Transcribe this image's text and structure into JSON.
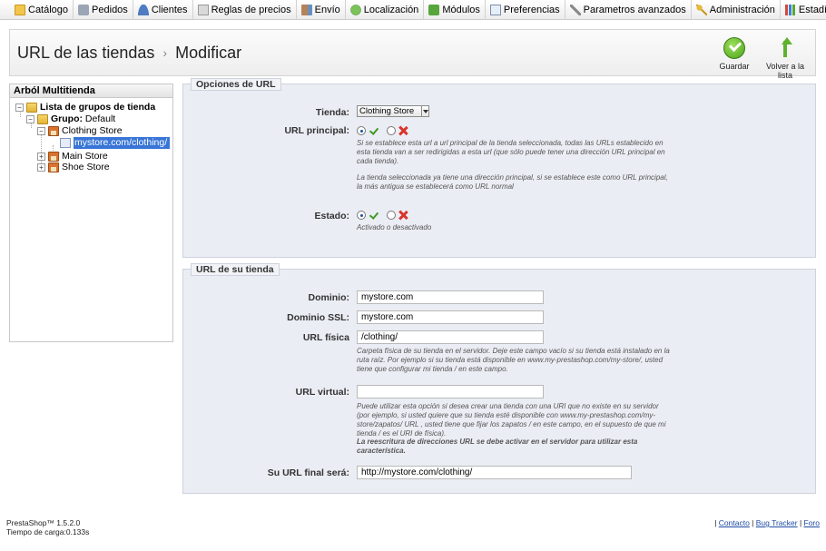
{
  "menu": {
    "items": [
      {
        "label": "Catálogo",
        "icon": "folder-icon"
      },
      {
        "label": "Pedidos",
        "icon": "cart-icon"
      },
      {
        "label": "Clientes",
        "icon": "customers-icon"
      },
      {
        "label": "Reglas de precios",
        "icon": "price-rules-icon"
      },
      {
        "label": "Envío",
        "icon": "truck-icon"
      },
      {
        "label": "Localización",
        "icon": "globe-icon"
      },
      {
        "label": "Módulos",
        "icon": "puzzle-icon"
      },
      {
        "label": "Preferencias",
        "icon": "preferences-icon"
      },
      {
        "label": "Parametros avanzados",
        "icon": "wrench-icon"
      },
      {
        "label": "Administración",
        "icon": "key-icon"
      },
      {
        "label": "Estadísticas",
        "icon": "stats-icon"
      }
    ]
  },
  "header": {
    "title_main": "URL de las tiendas",
    "separator": "›",
    "title_sub": "Modificar",
    "save_label": "Guardar",
    "back_label": "Volver a la lista"
  },
  "tree": {
    "title": "Arból Multitienda",
    "root": "Lista de grupos de tienda",
    "group_prefix": "Grupo:",
    "group_name": "Default",
    "shops": [
      "Clothing Store",
      "Main Store",
      "Shoe Store"
    ],
    "selected_url": "mystore.com/clothing/"
  },
  "url_options": {
    "legend": "Opciones de URL",
    "shop_label": "Tienda:",
    "shop_value": "Clothing Store",
    "main_label": "URL principal:",
    "main_hint_1": "Si se establece esta url a url principal de la tienda seleccionada, todas las URLs establecido en esta tienda van a ser redirigidas a esta url (que sólo puede tener una dirección URL principal en cada tienda).",
    "main_hint_2": "La tienda seleccionada ya tiene una dirección principal, si se establece este como URL principal, la más antigua se establecerá como URL normal",
    "status_label": "Estado:",
    "status_hint": "Activado o desactivado"
  },
  "shop_url": {
    "legend": "URL de su tienda",
    "domain_label": "Dominio:",
    "domain_value": "mystore.com",
    "domain_ssl_label": "Dominio SSL:",
    "domain_ssl_value": "mystore.com",
    "physical_label": "URL física",
    "physical_value": "/clothing/",
    "physical_hint": "Carpeta física de su tienda en el servidor. Deje este campo vacío si su tienda está instalado en la ruta raíz. Por ejemplo si su tienda está disponible en www.my-prestashop.com/my-store/, usted tiene que configurar mi tienda / en este campo.",
    "virtual_label": "URL virtual:",
    "virtual_value": "",
    "virtual_hint": "Puede utilizar esta opción si desea crear una tienda con una URI que no existe en su servidor (por ejemplo, si usted quiere que su tienda esté disponible con www.my-prestashop.com/my-store/zapatos/ URL , usted tiene que fijar los zapatos / en este campo, en el supuesto de que mi tienda / es el URI de física).",
    "virtual_hint_bold": "La reescritura de direcciones URL se debe activar en el servidor para utilizar esta característica.",
    "final_label": "Su URL final será:",
    "final_value": "http://mystore.com/clothing/"
  },
  "footer": {
    "version": "PrestaShop™ 1.5.2.0",
    "load_time": "Tiempo de carga:0.133s",
    "contact": "Contacto",
    "bug_tracker": "Bug Tracker",
    "forum": "Foro"
  }
}
